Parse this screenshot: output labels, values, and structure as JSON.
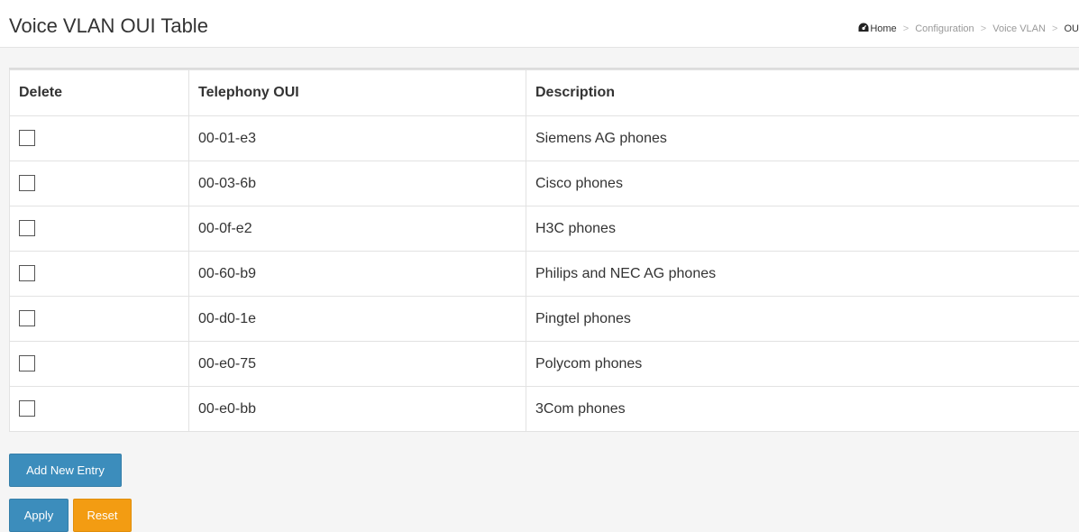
{
  "header": {
    "title": "Voice VLAN OUI Table",
    "breadcrumb": {
      "home": "Home",
      "items": [
        "Configuration",
        "Voice VLAN",
        "OU"
      ]
    }
  },
  "table": {
    "columns": [
      "Delete",
      "Telephony OUI",
      "Description"
    ],
    "rows": [
      {
        "oui": "00-01-e3",
        "description": "Siemens AG phones"
      },
      {
        "oui": "00-03-6b",
        "description": "Cisco phones"
      },
      {
        "oui": "00-0f-e2",
        "description": "H3C phones"
      },
      {
        "oui": "00-60-b9",
        "description": "Philips and NEC AG phones"
      },
      {
        "oui": "00-d0-1e",
        "description": "Pingtel phones"
      },
      {
        "oui": "00-e0-75",
        "description": "Polycom phones"
      },
      {
        "oui": "00-e0-bb",
        "description": "3Com phones"
      }
    ]
  },
  "buttons": {
    "add_new_entry": "Add New Entry",
    "apply": "Apply",
    "reset": "Reset"
  },
  "colors": {
    "primary": "#3c8dbc",
    "warning": "#f39c12"
  }
}
